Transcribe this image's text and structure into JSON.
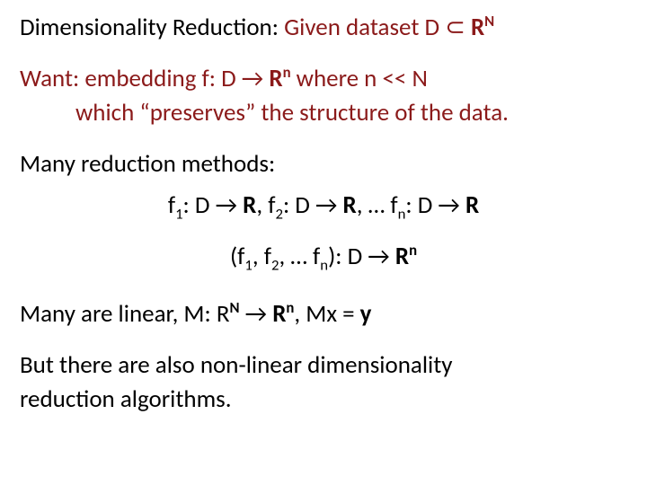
{
  "title": {
    "label": "Dimensionality Reduction:",
    "given": "Given dataset  D ",
    "subset": "⊂",
    "space": " R",
    "exp": "N"
  },
  "want": {
    "prefix": "Want:  embedding   f:  D ",
    "arrow": "→",
    "target": " R",
    "exp": "n",
    "cond": "  where n << N",
    "line2": "which “preserves” the structure of the data."
  },
  "methods": {
    "heading": "Many reduction methods:",
    "maps_f1": "f",
    "s1": "1",
    "colonD": ":  D ",
    "arrow": "→",
    "R": "  R",
    "comma": ", ",
    "f2": "f",
    "s2": "2",
    "dots": ", … f",
    "sn": "n",
    "tuple_open": "(f",
    "t1": "1",
    "t_comma": ", f",
    "t2": "2",
    "t_dots": ", … f",
    "tn": "n",
    "tuple_close": "):  D ",
    "tuple_arrow": "→",
    "tuple_R": "  R",
    "tuple_exp": "n"
  },
  "linear": {
    "prefix": "Many are linear,   M:  R",
    "expN": "N",
    "arrow": " →",
    "mid": "  R",
    "expn": "n",
    "suffix": ",  Mx = ",
    "y": "y"
  },
  "nonlinear": {
    "l1": "But there are also non-linear dimensionality",
    "l2": "reduction algorithms."
  }
}
